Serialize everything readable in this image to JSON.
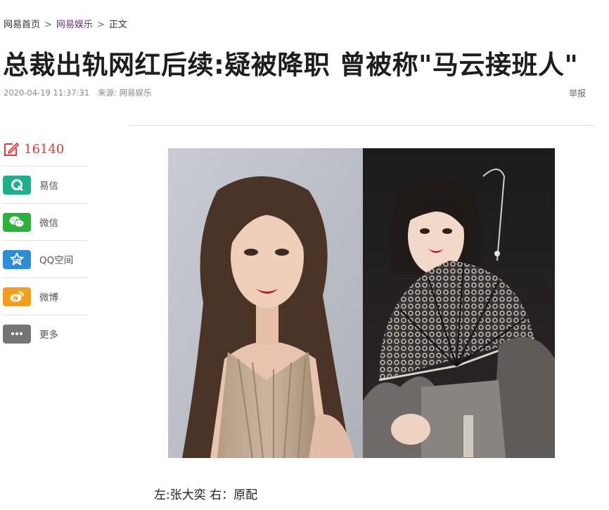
{
  "breadcrumb": {
    "home": "网易首页",
    "section": "网易娱乐",
    "current": "正文",
    "separator": ">"
  },
  "article": {
    "title": "总裁出轨网红后续:疑被降职 曾被称\"马云接班人\"",
    "datetime": "2020-04-19 11:37:31",
    "source_label": "来源:",
    "source": "网易娱乐",
    "report": "举报",
    "caption": "左:张大奕 右：原配"
  },
  "sidebar": {
    "comment_count": "16140",
    "comment_icon": "edit-comment-icon",
    "share": [
      {
        "label": "易信",
        "icon": "yixin-icon",
        "color": "#1fae8d"
      },
      {
        "label": "微信",
        "icon": "wechat-icon",
        "color": "#2ab339"
      },
      {
        "label": "QQ空间",
        "icon": "qzone-icon",
        "color": "#2b8ed6"
      },
      {
        "label": "微博",
        "icon": "weibo-icon",
        "color": "#f49d16"
      },
      {
        "label": "更多",
        "icon": "more-icon",
        "color": "#757575"
      }
    ]
  },
  "colors": {
    "section_link": "#6b2b82",
    "comment_count": "#e0393a",
    "divider": "#dcdcdc"
  }
}
